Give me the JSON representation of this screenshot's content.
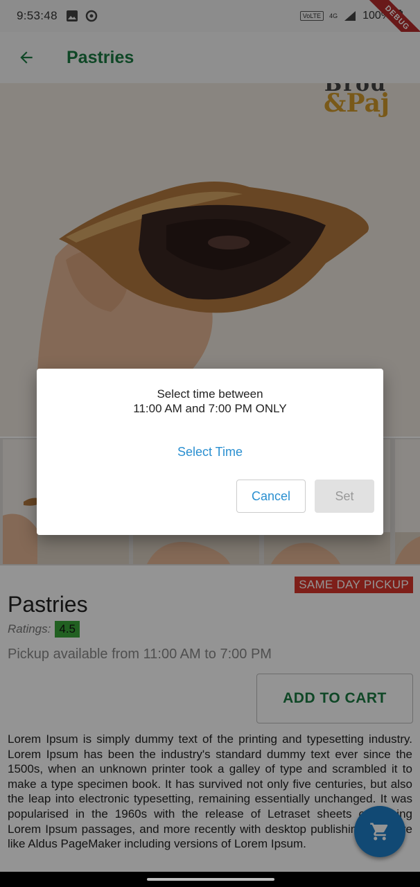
{
  "status_bar": {
    "time": "9:53:48",
    "volte": "VoLTE",
    "network": "4G",
    "battery": "100%",
    "debug_banner": "DEBUG"
  },
  "app_bar": {
    "title": "Pastries",
    "back_icon": "arrow-back-icon"
  },
  "hero": {
    "brand_top": "Brod",
    "brand_bottom": "&Paj"
  },
  "product": {
    "badge": "SAME DAY PICKUP",
    "name": "Pastries",
    "ratings_label": "Ratings:",
    "rating": "4.5",
    "pickup_text": "Pickup available from 11:00 AM to 7:00 PM",
    "add_to_cart": "ADD TO CART",
    "description": "Lorem Ipsum is simply dummy text of the printing and typesetting industry. Lorem Ipsum has been the industry's standard dummy text ever since the 1500s, when an unknown printer took a galley of type and scrambled it to make a type specimen book. It has survived not only five centuries, but also the leap into electronic typesetting, remaining essentially unchanged. It was popularised in the 1960s with the release of Letraset sheets containing Lorem Ipsum passages, and more recently with desktop publishing software like Aldus PageMaker including versions of Lorem Ipsum."
  },
  "fab": {
    "icon": "cart-icon"
  },
  "dialog": {
    "message_line1": "Select time between",
    "message_line2": "11:00 AM and 7:00 PM ONLY",
    "select_time": "Select Time",
    "cancel": "Cancel",
    "set": "Set"
  },
  "colors": {
    "accent_green": "#1a7a43",
    "accent_blue": "#2a8fd0",
    "badge_red": "#d9362b",
    "rating_green": "#3aa63a",
    "fab_blue": "#1e7fc9"
  }
}
